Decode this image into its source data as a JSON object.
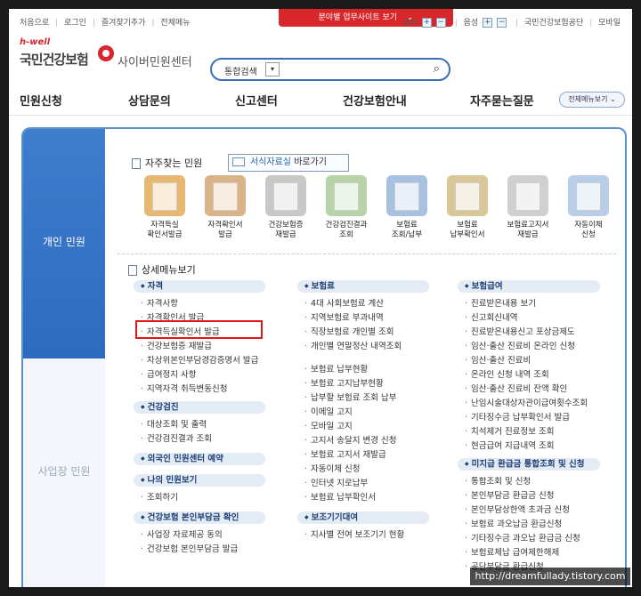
{
  "top": {
    "left_links": [
      "처음으로",
      "로그인",
      "즐겨찾기추가",
      "전체메뉴"
    ],
    "center_banner": "분야별 업무사이트 보기",
    "font_label": "글자",
    "sound_label": "음성",
    "right_links": [
      "국민건강보험공단",
      "모바일"
    ]
  },
  "logo": {
    "tagline": "h-well",
    "brand": "국민건강보험",
    "subtitle": "사이버민원센터"
  },
  "search": {
    "select_label": "통합검색",
    "placeholder": ""
  },
  "gnb": {
    "items": [
      "민원신청",
      "상담문의",
      "신고센터",
      "건강보험안내",
      "자주묻는질문"
    ],
    "all_menu": "전체메뉴보기"
  },
  "side": {
    "personal": "개인 민원",
    "business": "사업장 민원"
  },
  "frequent": {
    "title": "자주찾는 민원",
    "forms_btn_prefix": "서식자료실",
    "forms_btn_suffix": "바로가기",
    "items": [
      {
        "line1": "자격득실",
        "line2": "확인서발급",
        "color": "#e7b872"
      },
      {
        "line1": "자격확인서",
        "line2": "발급",
        "color": "#d9b488"
      },
      {
        "line1": "건강보험증",
        "line2": "재발급",
        "color": "#c8c8c8"
      },
      {
        "line1": "건강검진결과",
        "line2": "조회",
        "color": "#b9d3a8"
      },
      {
        "line1": "보험료",
        "line2": "조회/납부",
        "color": "#a9c1e0"
      },
      {
        "line1": "보험료",
        "line2": "납부확인서",
        "color": "#d9c79a"
      },
      {
        "line1": "보험료고지서",
        "line2": "재발급",
        "color": "#d0d0d0"
      },
      {
        "line1": "자동이체",
        "line2": "신청",
        "color": "#b8cde8"
      }
    ]
  },
  "detail": {
    "title": "상세메뉴보기",
    "col1": {
      "cat1": "자격",
      "cat1_items": [
        "자격사항",
        "자격확인서 발급",
        "자격득실확인서 발급",
        "건강보험증 재발급",
        "차상위본인부담경감증명서 발급",
        "급여정지 사항",
        "지역자격 취득변동신청"
      ],
      "cat2": "건강검진",
      "cat2_items": [
        "대상조회 및 출력",
        "건강검진결과 조회"
      ],
      "cat3": "외국인 민원센터 예약",
      "cat4": "나의 민원보기",
      "cat4_items": [
        "조회하기"
      ],
      "cat5": "건강보험 본인부담금 확인",
      "cat5_items": [
        "사업장 자료제공 동의",
        "건강보험 본인부담금 발급"
      ]
    },
    "col2": {
      "cat1": "보험료",
      "cat1_items": [
        "4대 사회보험료 계산",
        "지역보험료 부과내역",
        "직장보험료 개인별 조회",
        "개인별 연말정산 내역조회"
      ],
      "cat1_items_b": [
        "보험료 납부현황",
        "보험료 고지납부현황",
        "납부할 보험료 조회 납부",
        "이메일 고지",
        "모바일 고지",
        "고지서 송달지 변경 신청",
        "보험료 고지서 재발급",
        "자동이체 신청",
        "인터넷 지로납부",
        "보험료 납부확인서"
      ],
      "cat2": "보조기기대여",
      "cat2_items": [
        "지사별 전여 보조기기 현황"
      ]
    },
    "col3": {
      "cat1": "보험급여",
      "cat1_items": [
        "진료받은내용 보기",
        "신고회신내역",
        "진료받은내용신고 포상금제도",
        "임산·출산 진료비 온라인 신청",
        "임산·출산 진료비",
        "온라인 신청 내역 조회",
        "임산·출산 진료비 잔액 확인",
        "난임시술대상자관이급여횟수조회",
        "기타징수금 납부확인서 발급",
        "치석제거 진료정보 조회",
        "현금급여 지급내역 조회"
      ],
      "cat2": "미지급 환급금 통합조회 및 신청",
      "cat2_items": [
        "통합조회 및 신청",
        "본인부담금 환급금 신청",
        "본인부담상한액 초과금 신청",
        "보험료 과오납금 환급신청",
        "기타징수금 과오납 환급금 신청",
        "보험료체납 급여제한해제",
        "공단부담금 환급신청"
      ]
    }
  },
  "watermark": "http://dreamfullady.tistory.com"
}
